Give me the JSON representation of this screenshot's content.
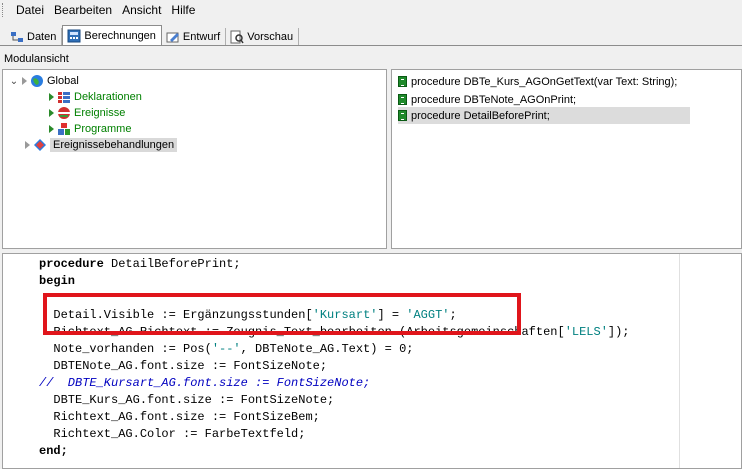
{
  "menu": [
    "Datei",
    "Bearbeiten",
    "Ansicht",
    "Hilfe"
  ],
  "tabs": [
    {
      "label": "Daten",
      "icon": "data-icon",
      "active": false
    },
    {
      "label": "Berechnungen",
      "icon": "calc-icon",
      "active": true
    },
    {
      "label": "Entwurf",
      "icon": "design-icon",
      "active": false
    },
    {
      "label": "Vorschau",
      "icon": "preview-icon",
      "active": false
    }
  ],
  "module_header": "Modulansicht",
  "tree": {
    "global": "Global",
    "deklarationen": "Deklarationen",
    "ereignisse": "Ereignisse",
    "programme": "Programme",
    "ereignisbehandlungen": "Ereignissebehandlungen"
  },
  "procedures": [
    "procedure DBTe_Kurs_AGOnGetText(var Text: String);",
    "procedure DBTeNote_AGOnPrint;",
    "procedure DetailBeforePrint;"
  ],
  "code": {
    "l1_kw": "procedure",
    "l1_rest": " DetailBeforePrint;",
    "l2": "begin",
    "l3_a": "  Detail.Visible := Ergänzungsstunden[",
    "l3_s1": "'Kursart'",
    "l3_b": "] = ",
    "l3_s2": "'AGGT'",
    "l3_c": ";",
    "l4_a": "  Richtext_AG.Richtext := Zeugnis_Text_bearbeiten (Arbeitsgemeinschaften[",
    "l4_s": "'LELS'",
    "l4_b": "]);",
    "l5_a": "  Note_vorhanden := Pos(",
    "l5_s": "'--'",
    "l5_b": ", DBTeNote_AG.Text) = 0;",
    "l6": "  DBTENote_AG.font.size := FontSizeNote;",
    "l7": "//  DBTE_Kursart_AG.font.size := FontSizeNote;",
    "l8": "  DBTE_Kurs_AG.font.size := FontSizeNote;",
    "l9": "  Richtext_AG.font.size := FontSizeBem;",
    "l10": "  Richtext_AG.Color := FarbeTextfeld;",
    "l11": "end;"
  },
  "colors": {
    "highlight": "#e0151b",
    "keyword_string": "#008080",
    "comment": "#0000c0"
  }
}
